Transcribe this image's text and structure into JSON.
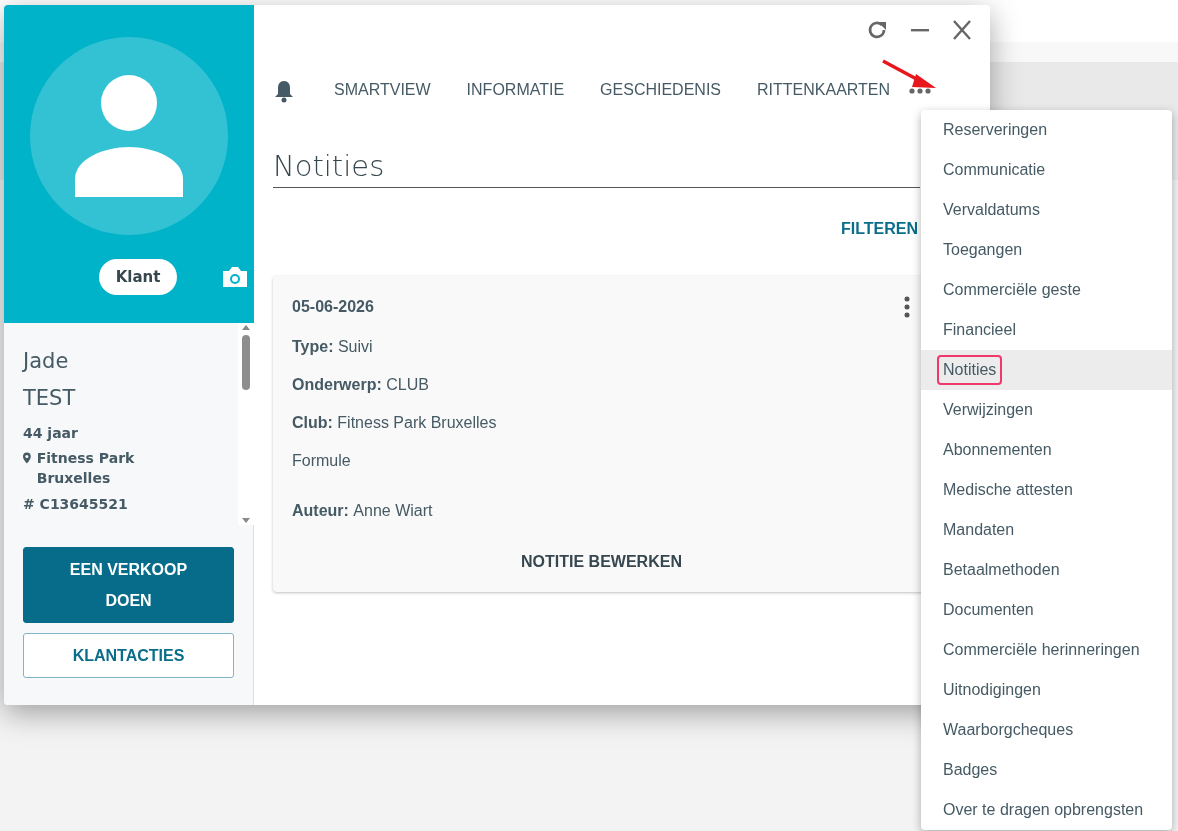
{
  "profile": {
    "badge": "Klant",
    "first_name": "Jade",
    "last_name": "TEST",
    "age": "44 jaar",
    "club": "Fitness Park Bruxelles",
    "member_id": "# C13645521"
  },
  "actions": [
    {
      "label": "EEN VERKOOP DOEN",
      "kind": "primary"
    },
    {
      "label": "KLANTACTIES",
      "kind": "outline"
    }
  ],
  "tabs": [
    {
      "label": "SMARTVIEW",
      "selected": false
    },
    {
      "label": "INFORMATIE",
      "selected": false
    },
    {
      "label": "GESCHIEDENIS",
      "selected": false
    },
    {
      "label": "RITTENKAARTEN",
      "selected": false
    }
  ],
  "section_title": "Notities",
  "filter_label": "FILTEREN",
  "note": {
    "date": "05-06-2026",
    "fields": [
      {
        "label": "Type:",
        "value": "Suivi"
      },
      {
        "label": "Onderwerp:",
        "value": "CLUB"
      },
      {
        "label": "Club:",
        "value": "Fitness Park Bruxelles"
      },
      {
        "value": "Formule"
      },
      {
        "label": "Auteur:",
        "value": "Anne Wiart"
      }
    ],
    "edit_label": "NOTITIE BEWERKEN"
  },
  "menu": [
    {
      "label": "Reserveringen",
      "selected": false
    },
    {
      "label": "Communicatie",
      "selected": false
    },
    {
      "label": "Vervaldatums",
      "selected": false
    },
    {
      "label": "Toegangen",
      "selected": false
    },
    {
      "label": "Commerciële geste",
      "selected": false
    },
    {
      "label": "Financieel",
      "selected": false
    },
    {
      "label": "Notities",
      "selected": true
    },
    {
      "label": "Verwijzingen",
      "selected": false
    },
    {
      "label": "Abonnementen",
      "selected": false
    },
    {
      "label": "Medische attesten",
      "selected": false
    },
    {
      "label": "Mandaten",
      "selected": false
    },
    {
      "label": "Betaalmethoden",
      "selected": false
    },
    {
      "label": "Documenten",
      "selected": false
    },
    {
      "label": "Commerciële herinneringen",
      "selected": false
    },
    {
      "label": "Uitnodigingen",
      "selected": false
    },
    {
      "label": "Waarborgcheques",
      "selected": false
    },
    {
      "label": "Badges",
      "selected": false
    },
    {
      "label": "Over te dragen opbrengsten",
      "selected": false
    }
  ]
}
